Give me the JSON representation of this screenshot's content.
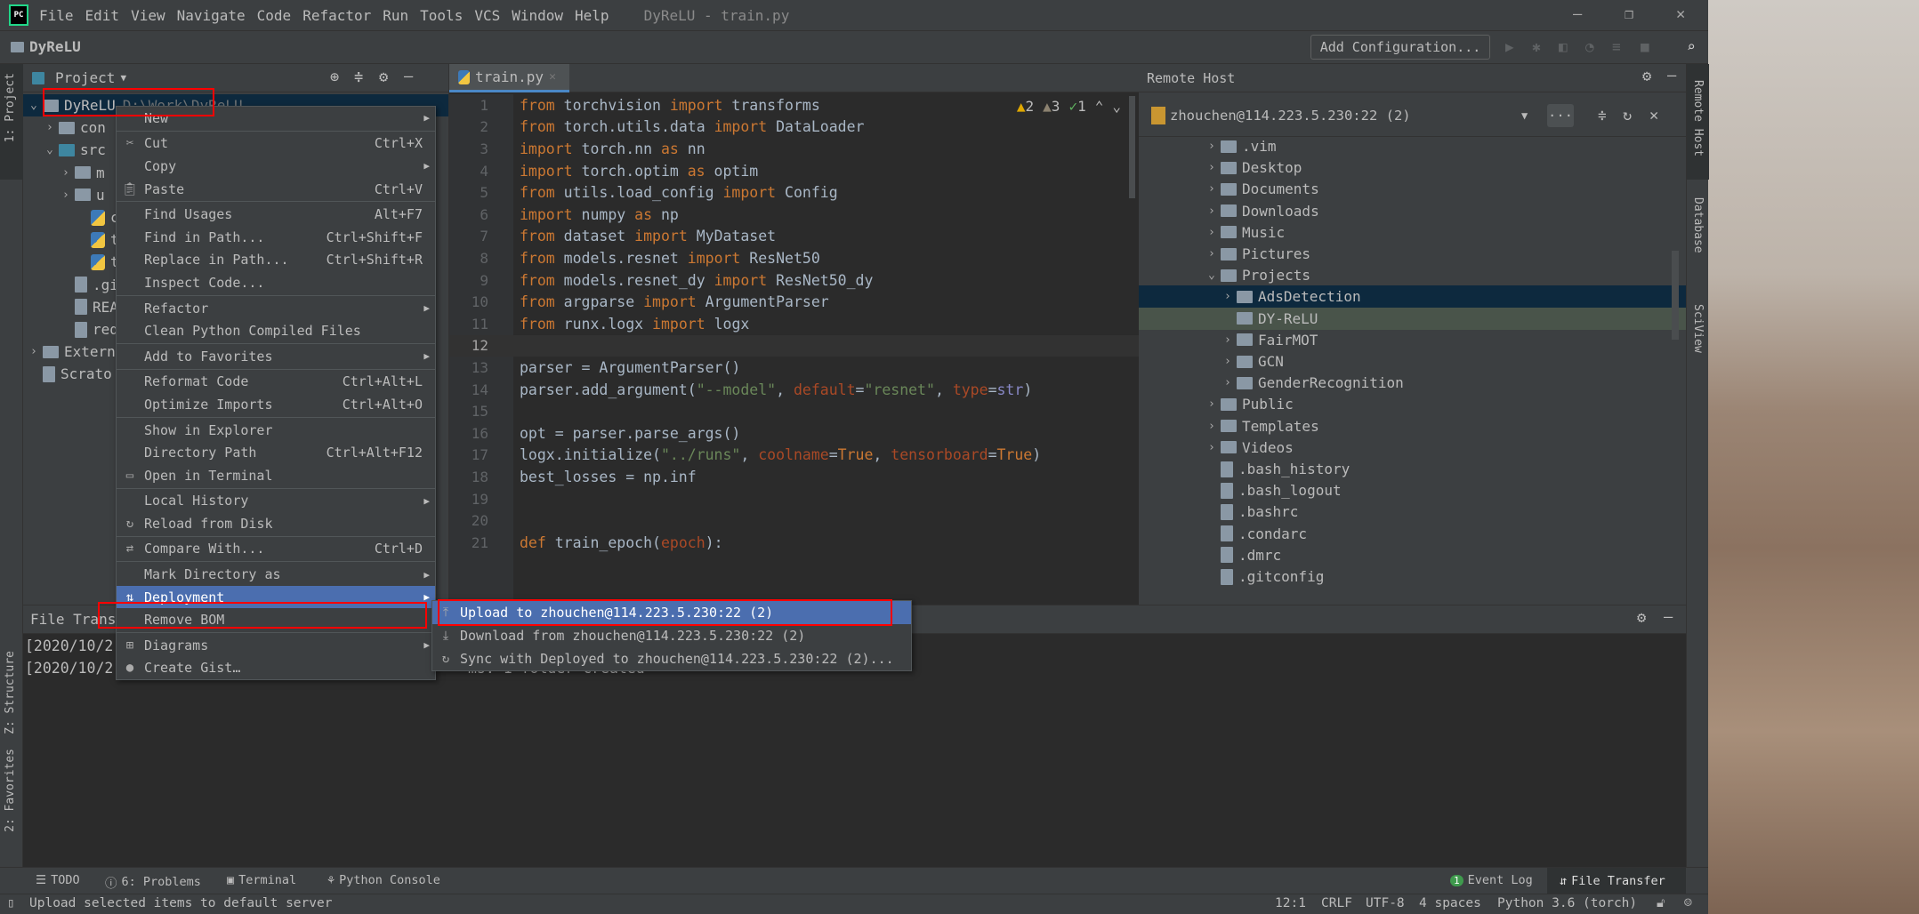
{
  "menubar": {
    "items": [
      "File",
      "Edit",
      "View",
      "Navigate",
      "Code",
      "Refactor",
      "Run",
      "Tools",
      "VCS",
      "Window",
      "Help"
    ],
    "window_title": "DyReLU - train.py",
    "logo": "PC"
  },
  "navbar": {
    "breadcrumb": "DyReLU",
    "add_configuration": "Add Configuration..."
  },
  "left_stripe": {
    "project": "1: Project",
    "structure": "Z: Structure",
    "favorites": "2: Favorites"
  },
  "right_stripe": {
    "remote_host": "Remote Host",
    "database": "Database",
    "sciview": "SciView"
  },
  "project": {
    "title": "Project",
    "items": [
      {
        "label": "DyReLU",
        "suffix": "D:\\Work\\DyReLU",
        "level": 0,
        "chev": "v",
        "icon": "folder",
        "selected": true
      },
      {
        "label": "con",
        "level": 1,
        "chev": ">",
        "icon": "folder"
      },
      {
        "label": "src",
        "level": 1,
        "chev": "v",
        "icon": "folder-blue"
      },
      {
        "label": "m",
        "level": 2,
        "chev": ">",
        "icon": "folder"
      },
      {
        "label": "u",
        "level": 2,
        "chev": ">",
        "icon": "folder"
      },
      {
        "label": "c",
        "level": 3,
        "icon": "python"
      },
      {
        "label": "t",
        "level": 3,
        "icon": "python"
      },
      {
        "label": "t",
        "level": 3,
        "icon": "python"
      },
      {
        "label": ".gi",
        "level": 2,
        "icon": "file"
      },
      {
        "label": "REA",
        "level": 2,
        "icon": "markdown"
      },
      {
        "label": "req",
        "level": 2,
        "icon": "file"
      },
      {
        "label": "Extern",
        "level": 0,
        "chev": ">",
        "icon": "library"
      },
      {
        "label": "Scrato",
        "level": 0,
        "icon": "scratch"
      }
    ]
  },
  "editor": {
    "tab": "train.py",
    "inspections": {
      "warnings": "2",
      "weak_warnings": "3",
      "typos": "1"
    },
    "lines": [
      [
        [
          "from",
          "kw"
        ],
        [
          " torchvision ",
          "tx"
        ],
        [
          "import",
          "kw"
        ],
        [
          " transforms",
          "tx"
        ]
      ],
      [
        [
          "from",
          "kw"
        ],
        [
          " torch.utils.data ",
          "tx"
        ],
        [
          "import",
          "kw"
        ],
        [
          " DataLoader",
          "tx"
        ]
      ],
      [
        [
          "import",
          "kw"
        ],
        [
          " torch.nn ",
          "tx"
        ],
        [
          "as",
          "kw"
        ],
        [
          " nn",
          "tx"
        ]
      ],
      [
        [
          "import",
          "kw"
        ],
        [
          " torch.optim ",
          "tx"
        ],
        [
          "as",
          "kw"
        ],
        [
          " optim",
          "tx"
        ]
      ],
      [
        [
          "from",
          "kw"
        ],
        [
          " utils.load_config ",
          "tx"
        ],
        [
          "import",
          "kw"
        ],
        [
          " Config",
          "tx"
        ]
      ],
      [
        [
          "import",
          "kw"
        ],
        [
          " numpy ",
          "tx"
        ],
        [
          "as",
          "kw"
        ],
        [
          " np",
          "tx"
        ]
      ],
      [
        [
          "from",
          "kw"
        ],
        [
          " dataset ",
          "tx"
        ],
        [
          "import",
          "kw"
        ],
        [
          " MyDataset",
          "tx"
        ]
      ],
      [
        [
          "from",
          "kw"
        ],
        [
          " models.resnet ",
          "tx"
        ],
        [
          "import",
          "kw"
        ],
        [
          " ResNet50",
          "tx"
        ]
      ],
      [
        [
          "from",
          "kw"
        ],
        [
          " models.resnet_dy ",
          "tx"
        ],
        [
          "import",
          "kw"
        ],
        [
          " ResNet50_dy",
          "tx"
        ]
      ],
      [
        [
          "from",
          "kw"
        ],
        [
          " argparse ",
          "tx"
        ],
        [
          "import",
          "kw"
        ],
        [
          " ArgumentParser",
          "tx"
        ]
      ],
      [
        [
          "from",
          "kw"
        ],
        [
          " runx.logx ",
          "tx"
        ],
        [
          "import",
          "kw"
        ],
        [
          " logx",
          "tx"
        ]
      ],
      [],
      [
        [
          "parser = ArgumentParser()",
          "tx"
        ]
      ],
      [
        [
          "parser.add_argument(",
          "tx"
        ],
        [
          "\"--model\"",
          "str"
        ],
        [
          ", ",
          "tx"
        ],
        [
          "default",
          "prm"
        ],
        [
          "=",
          "tx"
        ],
        [
          "\"resnet\"",
          "str"
        ],
        [
          ", ",
          "tx"
        ],
        [
          "type",
          "prm"
        ],
        [
          "=",
          "tx"
        ],
        [
          "str",
          "bi"
        ],
        [
          ")",
          "tx"
        ]
      ],
      [],
      [
        [
          "opt = parser.parse_args()",
          "tx"
        ]
      ],
      [
        [
          "logx.initialize(",
          "tx"
        ],
        [
          "\"../runs\"",
          "str"
        ],
        [
          ", ",
          "tx"
        ],
        [
          "coolname",
          "prm"
        ],
        [
          "=",
          "tx"
        ],
        [
          "True",
          "kw"
        ],
        [
          ", ",
          "tx"
        ],
        [
          "tensorboard",
          "prm"
        ],
        [
          "=",
          "tx"
        ],
        [
          "True",
          "kw"
        ],
        [
          ")",
          "tx"
        ]
      ],
      [
        [
          "best_losses = np.inf",
          "tx"
        ]
      ],
      [],
      [],
      [
        [
          "def",
          "kw"
        ],
        [
          " train_epoch",
          "tx"
        ],
        [
          "(",
          "tx"
        ],
        [
          "epoch",
          "prm"
        ],
        [
          "):",
          "tx"
        ]
      ]
    ],
    "current_line": 12
  },
  "remote": {
    "title": "Remote Host",
    "server": "zhouchen@114.223.5.230:22 (2)",
    "more": "...",
    "items": [
      {
        "label": ".vim",
        "level": 0,
        "chev": ">",
        "icon": "folder"
      },
      {
        "label": "Desktop",
        "level": 0,
        "chev": ">",
        "icon": "folder"
      },
      {
        "label": "Documents",
        "level": 0,
        "chev": ">",
        "icon": "folder"
      },
      {
        "label": "Downloads",
        "level": 0,
        "chev": ">",
        "icon": "folder"
      },
      {
        "label": "Music",
        "level": 0,
        "chev": ">",
        "icon": "folder"
      },
      {
        "label": "Pictures",
        "level": 0,
        "chev": ">",
        "icon": "folder"
      },
      {
        "label": "Projects",
        "level": 0,
        "chev": "v",
        "icon": "folder"
      },
      {
        "label": "AdsDetection",
        "level": 1,
        "chev": ">",
        "icon": "folder",
        "state": "selected"
      },
      {
        "label": "DY-ReLU",
        "level": 1,
        "icon": "folder",
        "state": "mapped"
      },
      {
        "label": "FairMOT",
        "level": 1,
        "chev": ">",
        "icon": "folder"
      },
      {
        "label": "GCN",
        "level": 1,
        "chev": ">",
        "icon": "folder"
      },
      {
        "label": "GenderRecognition",
        "level": 1,
        "chev": ">",
        "icon": "folder"
      },
      {
        "label": "Public",
        "level": 0,
        "chev": ">",
        "icon": "folder"
      },
      {
        "label": "Templates",
        "level": 0,
        "chev": ">",
        "icon": "folder"
      },
      {
        "label": "Videos",
        "level": 0,
        "chev": ">",
        "icon": "folder"
      },
      {
        "label": ".bash_history",
        "level": 0,
        "icon": "unknown-file"
      },
      {
        "label": ".bash_logout",
        "level": 0,
        "icon": "unknown-file"
      },
      {
        "label": ".bashrc",
        "level": 0,
        "icon": "unknown-file"
      },
      {
        "label": ".condarc",
        "level": 0,
        "icon": "unknown-file"
      },
      {
        "label": ".dmrc",
        "level": 0,
        "icon": "unknown-file"
      },
      {
        "label": ".gitconfig",
        "level": 0,
        "icon": "unknown-file"
      }
    ]
  },
  "file_transfer": {
    "title": "File Transf",
    "log": [
      "[2020/10/2",
      "[2020/10/2"
    ],
    "log_tail": "ms: 1 folder created"
  },
  "context_menu": {
    "groups": [
      [
        {
          "label": "New",
          "submenu": true
        }
      ],
      [
        {
          "label": "Cut",
          "shortcut": "Ctrl+X",
          "icon": "scissors-icon"
        },
        {
          "label": "Copy",
          "submenu": true
        },
        {
          "label": "Paste",
          "shortcut": "Ctrl+V",
          "icon": "clipboard-icon"
        }
      ],
      [
        {
          "label": "Find Usages",
          "shortcut": "Alt+F7"
        },
        {
          "label": "Find in Path...",
          "shortcut": "Ctrl+Shift+F"
        },
        {
          "label": "Replace in Path...",
          "shortcut": "Ctrl+Shift+R"
        },
        {
          "label": "Inspect Code..."
        }
      ],
      [
        {
          "label": "Refactor",
          "submenu": true
        },
        {
          "label": "Clean Python Compiled Files"
        }
      ],
      [
        {
          "label": "Add to Favorites",
          "submenu": true
        }
      ],
      [
        {
          "label": "Reformat Code",
          "shortcut": "Ctrl+Alt+L"
        },
        {
          "label": "Optimize Imports",
          "shortcut": "Ctrl+Alt+O"
        }
      ],
      [
        {
          "label": "Show in Explorer"
        },
        {
          "label": "Directory Path",
          "shortcut": "Ctrl+Alt+F12"
        },
        {
          "label": "Open in Terminal",
          "icon": "terminal-icon"
        }
      ],
      [
        {
          "label": "Local History",
          "submenu": true
        },
        {
          "label": "Reload from Disk",
          "icon": "reload-icon"
        }
      ],
      [
        {
          "label": "Compare With...",
          "shortcut": "Ctrl+D",
          "icon": "compare-icon"
        }
      ],
      [
        {
          "label": "Mark Directory as",
          "submenu": true
        },
        {
          "label": "Deployment",
          "submenu": true,
          "icon": "deployment-icon",
          "selected": true
        },
        {
          "label": "Remove BOM"
        }
      ],
      [
        {
          "label": "Diagrams",
          "submenu": true,
          "icon": "diagram-icon"
        },
        {
          "label": "Create Gist…",
          "icon": "github-icon"
        }
      ]
    ]
  },
  "deployment_submenu": [
    {
      "label": "Upload to zhouchen@114.223.5.230:22 (2)",
      "icon": "upload-icon",
      "selected": true
    },
    {
      "label": "Download from zhouchen@114.223.5.230:22 (2)",
      "icon": "download-icon"
    },
    {
      "label": "Sync with Deployed to zhouchen@114.223.5.230:22 (2)...",
      "icon": "sync-icon"
    }
  ],
  "toolwindows": {
    "todo": "TODO",
    "problems": "6: Problems",
    "terminal": "Terminal",
    "python_console": "Python Console",
    "event_log": "Event Log",
    "event_log_count": "1",
    "file_transfer": "File Transfer"
  },
  "statusbar": {
    "message": "Upload selected items to default server",
    "position": "12:1",
    "line_sep": "CRLF",
    "encoding": "UTF-8",
    "indent": "4 spaces",
    "interpreter": "Python 3.6 (torch)"
  },
  "colors": {
    "selection": "#0d293e",
    "menu_selected": "#4b6eaf",
    "highlight_box": "#ff0000",
    "keyword": "#cc7832",
    "string": "#6a8759"
  }
}
